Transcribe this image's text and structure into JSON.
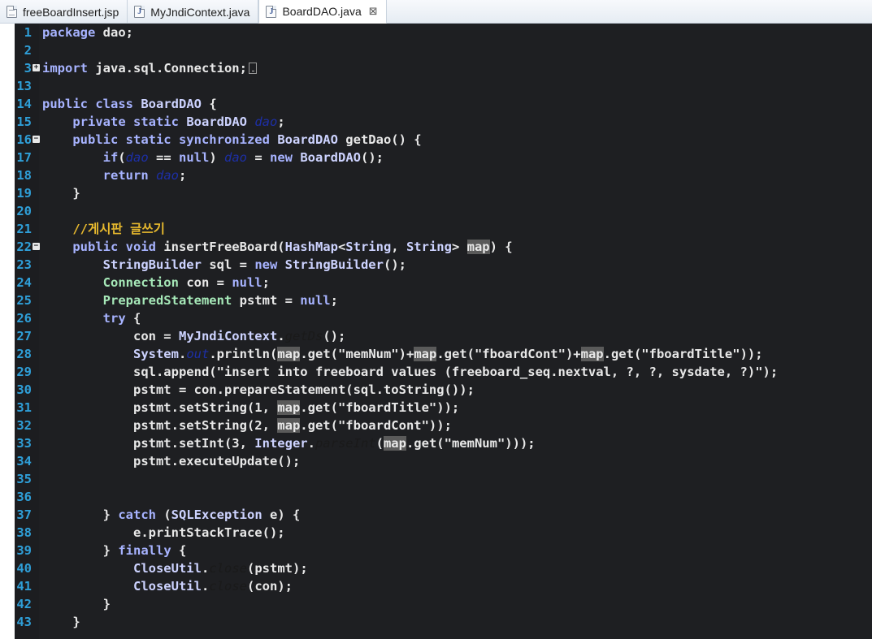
{
  "tabs": [
    {
      "label": "freeBoardInsert.jsp",
      "icon": "jsp-file-icon",
      "active": false
    },
    {
      "label": "MyJndiContext.java",
      "icon": "java-file-icon",
      "active": false
    },
    {
      "label": "BoardDAO.java",
      "icon": "java-file-icon",
      "active": true,
      "close": "⊠"
    }
  ],
  "colors": {
    "line_numbers": "#2f9fd8",
    "keyword": "#a7b3ff",
    "comment": "#e6b82e",
    "static_field": "#1d2fa5",
    "editor_bg": "#1e1f22"
  },
  "editor": {
    "lines": [
      {
        "n": "1",
        "fold": "",
        "tokens": [
          [
            "kw",
            "package"
          ],
          [
            "plain",
            " dao;"
          ]
        ]
      },
      {
        "n": "2",
        "fold": "",
        "tokens": []
      },
      {
        "n": "3",
        "fold": "+",
        "tokens": [
          [
            "kw",
            "import"
          ],
          [
            "plain",
            " java.sql.Connection;"
          ],
          [
            "collapsed",
            ""
          ]
        ]
      },
      {
        "n": "13",
        "fold": "",
        "tokens": []
      },
      {
        "n": "14",
        "fold": "",
        "tokens": [
          [
            "kw",
            "public class"
          ],
          [
            "plain",
            " "
          ],
          [
            "cls",
            "BoardDAO"
          ],
          [
            "plain",
            " {"
          ]
        ]
      },
      {
        "n": "15",
        "fold": "",
        "tokens": [
          [
            "plain",
            "    "
          ],
          [
            "kw",
            "private static"
          ],
          [
            "plain",
            " "
          ],
          [
            "cls",
            "BoardDAO"
          ],
          [
            "plain",
            " "
          ],
          [
            "field",
            "dao"
          ],
          [
            "plain",
            ";"
          ]
        ]
      },
      {
        "n": "16",
        "fold": "−",
        "tokens": [
          [
            "plain",
            "    "
          ],
          [
            "kw",
            "public static synchronized"
          ],
          [
            "plain",
            " "
          ],
          [
            "cls",
            "BoardDAO"
          ],
          [
            "plain",
            " getDao() {"
          ]
        ]
      },
      {
        "n": "17",
        "fold": "",
        "tokens": [
          [
            "plain",
            "        "
          ],
          [
            "kw",
            "if"
          ],
          [
            "plain",
            "("
          ],
          [
            "field",
            "dao"
          ],
          [
            "plain",
            " == "
          ],
          [
            "kw",
            "null"
          ],
          [
            "plain",
            ") "
          ],
          [
            "field",
            "dao"
          ],
          [
            "plain",
            " = "
          ],
          [
            "kw",
            "new"
          ],
          [
            "plain",
            " "
          ],
          [
            "cls",
            "BoardDAO"
          ],
          [
            "plain",
            "();"
          ]
        ]
      },
      {
        "n": "18",
        "fold": "",
        "tokens": [
          [
            "plain",
            "        "
          ],
          [
            "kw",
            "return"
          ],
          [
            "plain",
            " "
          ],
          [
            "field",
            "dao"
          ],
          [
            "plain",
            ";"
          ]
        ]
      },
      {
        "n": "19",
        "fold": "",
        "tokens": [
          [
            "plain",
            "    }"
          ]
        ]
      },
      {
        "n": "20",
        "fold": "",
        "tokens": []
      },
      {
        "n": "21",
        "fold": "",
        "tokens": [
          [
            "plain",
            "    "
          ],
          [
            "cmt",
            "//게시판 글쓰기"
          ]
        ]
      },
      {
        "n": "22",
        "fold": "−",
        "tokens": [
          [
            "plain",
            "    "
          ],
          [
            "kw",
            "public void"
          ],
          [
            "plain",
            " insertFreeBoard("
          ],
          [
            "cls",
            "HashMap"
          ],
          [
            "plain",
            "<"
          ],
          [
            "cls",
            "String"
          ],
          [
            "plain",
            ", "
          ],
          [
            "cls",
            "String"
          ],
          [
            "plain",
            "> "
          ],
          [
            "param",
            "map"
          ],
          [
            "plain",
            ") {"
          ]
        ]
      },
      {
        "n": "23",
        "fold": "",
        "tokens": [
          [
            "plain",
            "        "
          ],
          [
            "cls",
            "StringBuilder"
          ],
          [
            "plain",
            " sql = "
          ],
          [
            "kw",
            "new"
          ],
          [
            "plain",
            " "
          ],
          [
            "cls",
            "StringBuilder"
          ],
          [
            "plain",
            "();"
          ]
        ]
      },
      {
        "n": "24",
        "fold": "",
        "tokens": [
          [
            "plain",
            "        "
          ],
          [
            "var",
            "Connection"
          ],
          [
            "plain",
            " con = "
          ],
          [
            "kw",
            "null"
          ],
          [
            "plain",
            ";"
          ]
        ]
      },
      {
        "n": "25",
        "fold": "",
        "tokens": [
          [
            "plain",
            "        "
          ],
          [
            "var",
            "PreparedStatement"
          ],
          [
            "plain",
            " pstmt = "
          ],
          [
            "kw",
            "null"
          ],
          [
            "plain",
            ";"
          ]
        ]
      },
      {
        "n": "26",
        "fold": "",
        "tokens": [
          [
            "plain",
            "        "
          ],
          [
            "kw",
            "try"
          ],
          [
            "plain",
            " {"
          ]
        ]
      },
      {
        "n": "27",
        "fold": "",
        "tokens": [
          [
            "plain",
            "            con = "
          ],
          [
            "cls",
            "MyJndiContext"
          ],
          [
            "plain",
            "."
          ],
          [
            "stm",
            "getDs"
          ],
          [
            "plain",
            "();"
          ]
        ]
      },
      {
        "n": "28",
        "fold": "",
        "tokens": [
          [
            "plain",
            "            "
          ],
          [
            "cls",
            "System"
          ],
          [
            "plain",
            "."
          ],
          [
            "stmblue",
            "out"
          ],
          [
            "plain",
            ".println("
          ],
          [
            "param",
            "map"
          ],
          [
            "plain",
            ".get(\"memNum\")+"
          ],
          [
            "param",
            "map"
          ],
          [
            "plain",
            ".get(\"fboardCont\")+"
          ],
          [
            "param",
            "map"
          ],
          [
            "plain",
            ".get(\"fboardTitle\"));"
          ]
        ]
      },
      {
        "n": "29",
        "fold": "",
        "tokens": [
          [
            "plain",
            "            sql.append(\"insert into freeboard values (freeboard_seq.nextval, ?, ?, sysdate, ?)\");"
          ]
        ]
      },
      {
        "n": "30",
        "fold": "",
        "tokens": [
          [
            "plain",
            "            pstmt = con.prepareStatement(sql.toString());"
          ]
        ]
      },
      {
        "n": "31",
        "fold": "",
        "tokens": [
          [
            "plain",
            "            pstmt.setString(1, "
          ],
          [
            "param",
            "map"
          ],
          [
            "plain",
            ".get(\"fboardTitle\"));"
          ]
        ]
      },
      {
        "n": "32",
        "fold": "",
        "tokens": [
          [
            "plain",
            "            pstmt.setString(2, "
          ],
          [
            "param",
            "map"
          ],
          [
            "plain",
            ".get(\"fboardCont\"));"
          ]
        ]
      },
      {
        "n": "33",
        "fold": "",
        "tokens": [
          [
            "plain",
            "            pstmt.setInt(3, "
          ],
          [
            "cls",
            "Integer"
          ],
          [
            "plain",
            "."
          ],
          [
            "stm",
            "parseInt"
          ],
          [
            "plain",
            "("
          ],
          [
            "param",
            "map"
          ],
          [
            "plain",
            ".get(\"memNum\")));"
          ]
        ]
      },
      {
        "n": "34",
        "fold": "",
        "tokens": [
          [
            "plain",
            "            pstmt.executeUpdate();"
          ]
        ]
      },
      {
        "n": "35",
        "fold": "",
        "tokens": []
      },
      {
        "n": "36",
        "fold": "",
        "tokens": []
      },
      {
        "n": "37",
        "fold": "",
        "tokens": [
          [
            "plain",
            "        } "
          ],
          [
            "kw",
            "catch"
          ],
          [
            "plain",
            " ("
          ],
          [
            "cls",
            "SQLException"
          ],
          [
            "plain",
            " e) {"
          ]
        ]
      },
      {
        "n": "38",
        "fold": "",
        "tokens": [
          [
            "plain",
            "            e.printStackTrace();"
          ]
        ]
      },
      {
        "n": "39",
        "fold": "",
        "tokens": [
          [
            "plain",
            "        } "
          ],
          [
            "kw",
            "finally"
          ],
          [
            "plain",
            " {"
          ]
        ]
      },
      {
        "n": "40",
        "fold": "",
        "tokens": [
          [
            "plain",
            "            "
          ],
          [
            "cls",
            "CloseUtil"
          ],
          [
            "plain",
            "."
          ],
          [
            "stm",
            "close"
          ],
          [
            "plain",
            "(pstmt);"
          ]
        ]
      },
      {
        "n": "41",
        "fold": "",
        "tokens": [
          [
            "plain",
            "            "
          ],
          [
            "cls",
            "CloseUtil"
          ],
          [
            "plain",
            "."
          ],
          [
            "stm",
            "close"
          ],
          [
            "plain",
            "(con);"
          ]
        ]
      },
      {
        "n": "42",
        "fold": "",
        "tokens": [
          [
            "plain",
            "        }"
          ]
        ]
      },
      {
        "n": "43",
        "fold": "",
        "tokens": [
          [
            "plain",
            "    }"
          ]
        ]
      }
    ]
  }
}
